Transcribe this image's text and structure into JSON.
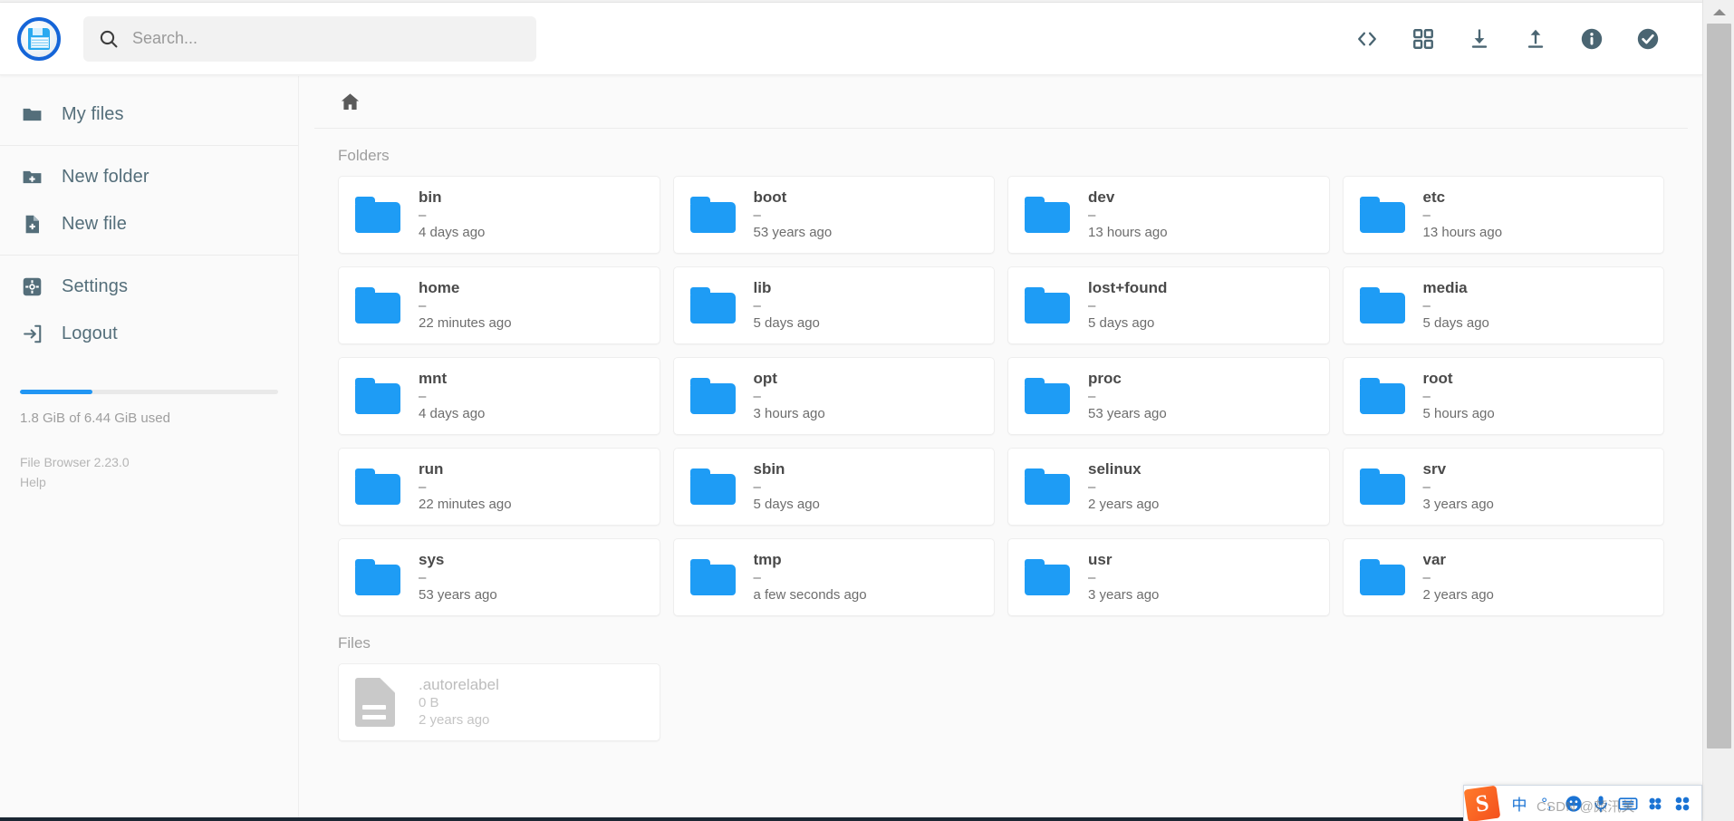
{
  "app": {
    "logo_icon": "floppy-disk-icon",
    "version_label": "File Browser 2.23.0",
    "help_label": "Help"
  },
  "search": {
    "icon": "search-icon",
    "placeholder": "Search...",
    "value": ""
  },
  "header_actions": [
    {
      "name": "code-brackets-icon",
      "label": "<>"
    },
    {
      "name": "grid-view-icon",
      "label": "Switch view"
    },
    {
      "name": "download-icon",
      "label": "Download"
    },
    {
      "name": "upload-icon",
      "label": "Upload"
    },
    {
      "name": "info-icon",
      "label": "Info"
    },
    {
      "name": "select-check-icon",
      "label": "Select"
    }
  ],
  "sidebar": {
    "groups": [
      {
        "items": [
          {
            "label": "My files",
            "icon": "folder-icon"
          }
        ]
      },
      {
        "items": [
          {
            "label": "New folder",
            "icon": "folder-plus-icon"
          },
          {
            "label": "New file",
            "icon": "file-plus-icon"
          }
        ]
      },
      {
        "items": [
          {
            "label": "Settings",
            "icon": "gear-icon"
          },
          {
            "label": "Logout",
            "icon": "logout-icon"
          }
        ]
      }
    ],
    "usage": {
      "percent": 28,
      "text": "1.8 GiB of 6.44 GiB used"
    }
  },
  "breadcrumb": {
    "home_icon": "home-icon",
    "path": "/"
  },
  "main": {
    "folders_heading": "Folders",
    "files_heading": "Files",
    "folder_color": "#1e9cf5",
    "folders": [
      {
        "name": "bin",
        "size": "–",
        "time": "4 days ago"
      },
      {
        "name": "boot",
        "size": "–",
        "time": "53 years ago"
      },
      {
        "name": "dev",
        "size": "–",
        "time": "13 hours ago"
      },
      {
        "name": "etc",
        "size": "–",
        "time": "13 hours ago"
      },
      {
        "name": "home",
        "size": "–",
        "time": "22 minutes ago"
      },
      {
        "name": "lib",
        "size": "–",
        "time": "5 days ago"
      },
      {
        "name": "lost+found",
        "size": "–",
        "time": "5 days ago"
      },
      {
        "name": "media",
        "size": "–",
        "time": "5 days ago"
      },
      {
        "name": "mnt",
        "size": "–",
        "time": "4 days ago"
      },
      {
        "name": "opt",
        "size": "–",
        "time": "3 hours ago"
      },
      {
        "name": "proc",
        "size": "–",
        "time": "53 years ago"
      },
      {
        "name": "root",
        "size": "–",
        "time": "5 hours ago"
      },
      {
        "name": "run",
        "size": "–",
        "time": "22 minutes ago"
      },
      {
        "name": "sbin",
        "size": "–",
        "time": "5 days ago"
      },
      {
        "name": "selinux",
        "size": "–",
        "time": "2 years ago"
      },
      {
        "name": "srv",
        "size": "–",
        "time": "3 years ago"
      },
      {
        "name": "sys",
        "size": "–",
        "time": "53 years ago"
      },
      {
        "name": "tmp",
        "size": "–",
        "time": "a few seconds ago"
      },
      {
        "name": "usr",
        "size": "–",
        "time": "3 years ago"
      },
      {
        "name": "var",
        "size": "–",
        "time": "2 years ago"
      }
    ],
    "files": [
      {
        "name": ".autorelabel",
        "size": "0 B",
        "time": "2 years ago",
        "hidden": true
      }
    ]
  },
  "ime": {
    "logo_text": "S",
    "items": [
      {
        "name": "chinese-mode-icon",
        "label": "中"
      },
      {
        "name": "punctuation-mode-icon",
        "label": "°,"
      },
      {
        "name": "emoji-icon",
        "label": "emoji"
      },
      {
        "name": "voice-input-icon",
        "label": "mic"
      },
      {
        "name": "soft-keyboard-icon",
        "label": "keyboard"
      },
      {
        "name": "ime-toolbox-icon",
        "label": "toolbox"
      },
      {
        "name": "ime-more-icon",
        "label": "more"
      }
    ],
    "watermark": "CSDN @颇汛关"
  }
}
